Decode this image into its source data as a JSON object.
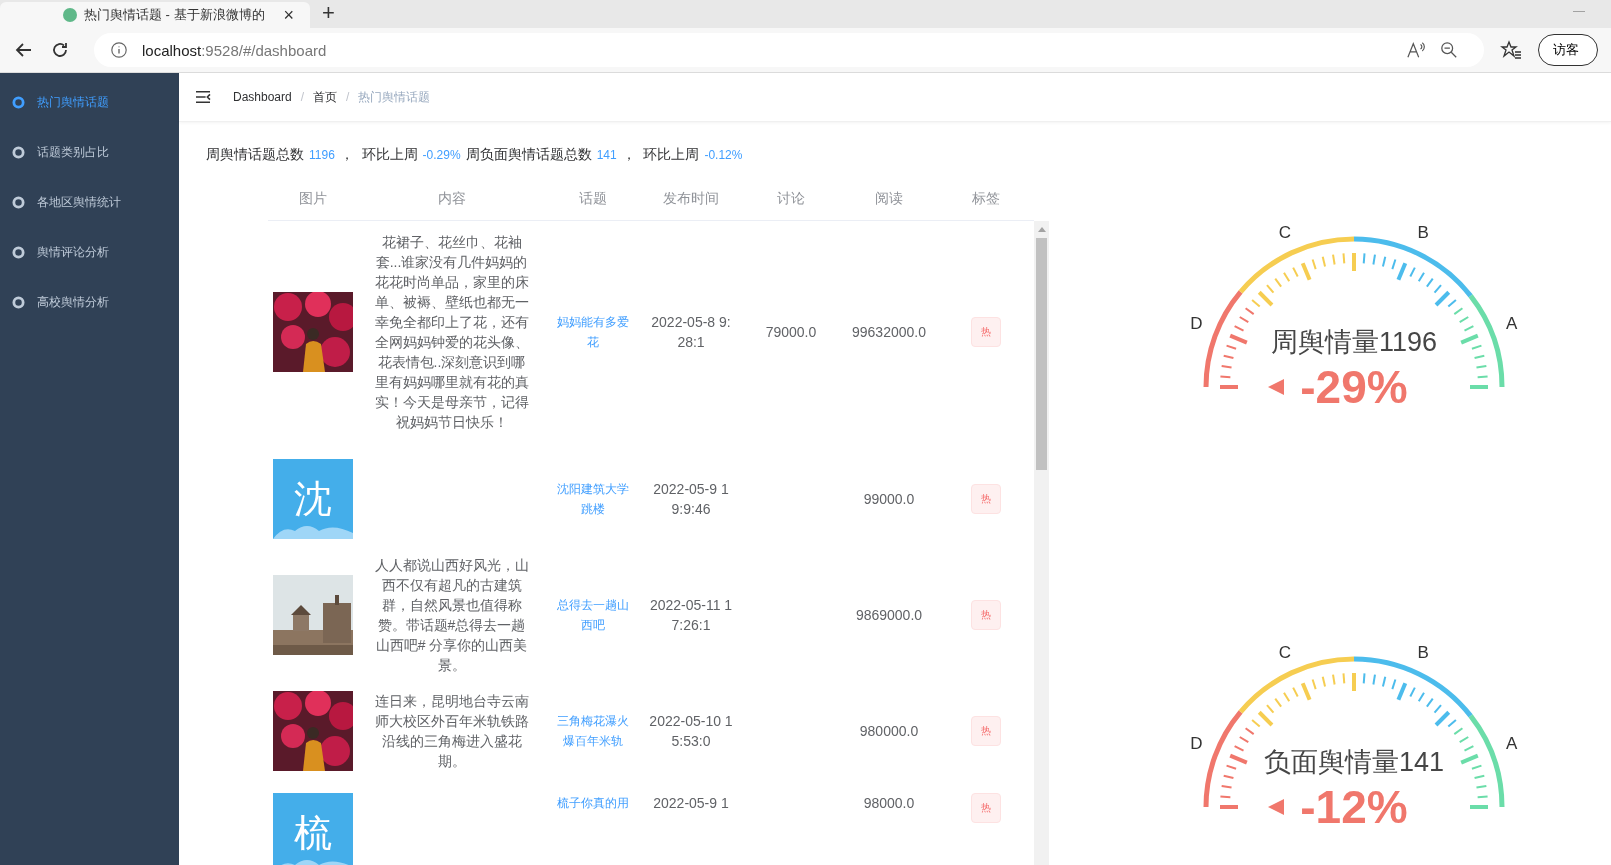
{
  "browser": {
    "tab_title": "热门舆情话题 - 基于新浪微博的",
    "tab_close": "×",
    "new_tab": "+",
    "minimize": "—",
    "url_host": "localhost",
    "url_path": ":9528/#/dashboard",
    "profile": "访客"
  },
  "sidebar": {
    "items": [
      {
        "label": "热门舆情话题",
        "selected": true
      },
      {
        "label": "话题类别占比",
        "selected": false
      },
      {
        "label": "各地区舆情统计",
        "selected": false
      },
      {
        "label": "舆情评论分析",
        "selected": false
      },
      {
        "label": "高校舆情分析",
        "selected": false
      }
    ]
  },
  "breadcrumb": [
    {
      "label": "Dashboard",
      "current": false
    },
    {
      "label": "首页",
      "current": false,
      "separator": "/"
    },
    {
      "label": "热门舆情话题",
      "current": true,
      "separator": "/"
    }
  ],
  "summary": [
    {
      "kind": "label",
      "text": "周舆情话题总数"
    },
    {
      "kind": "value",
      "text": "1196"
    },
    {
      "kind": "label",
      "text": "，  环比上周"
    },
    {
      "kind": "value",
      "text": "-0.29%"
    },
    {
      "kind": "label",
      "text": "周负面舆情话题总数"
    },
    {
      "kind": "value",
      "text": "141"
    },
    {
      "kind": "label",
      "text": "，  环比上周"
    },
    {
      "kind": "value",
      "text": "-0.12%"
    }
  ],
  "table": {
    "columns": [
      "图片",
      "内容",
      "话题",
      "发布时间",
      "讨论",
      "阅读",
      "标签"
    ],
    "rows": [
      {
        "content": "花裙子、花丝巾、花袖套...谁家没有几件妈妈的花花时尚单品，家里的床单、被褥、壁纸也都无一幸免全都印上了花，还有全网妈妈钟爱的花头像、花表情包..深刻意识到哪里有妈妈哪里就有花的真实！今天是母亲节，记得祝妈妈节日快乐！",
        "topic": "妈妈能有多爱花",
        "time": "2022-05-8 9:28:1",
        "discussion": "79000.0",
        "reads": "99632000.0",
        "tag": "热"
      },
      {
        "picture": {
          "kind": "letter",
          "letter": "沈"
        },
        "topic": "沈阳建筑大学跳楼",
        "time": "2022-05-9 19:9:46",
        "reads": "99000.0",
        "tag": "热"
      },
      {
        "content": "人人都说山西好风光，山西不仅有超凡的古建筑群，自然风景也值得称赞。带话题#总得去一趟山西吧# 分享你的山西美景。",
        "topic": "总得去一趟山西吧",
        "time": "2022-05-11 17:26:1",
        "reads": "9869000.0",
        "tag": "热"
      },
      {
        "content": "连日来，昆明地台寺云南师大校区外百年米轨铁路沿线的三角梅进入盛花期。",
        "topic": "三角梅花瀑火爆百年米轨",
        "time": "2022-05-10 15:53:0",
        "reads": "980000.0",
        "tag": "热"
      },
      {
        "picture": {
          "kind": "letter",
          "letter": "梳"
        },
        "topic": "梳子你真的用",
        "time": "2022-05-9 1",
        "reads": "98000.0",
        "tag": "热"
      }
    ]
  },
  "gauges": [
    {
      "title": "周舆情量1196",
      "percent": "-29%",
      "labels": [
        "D",
        "C",
        "B",
        "A"
      ]
    },
    {
      "title": "负面舆情量141",
      "percent": "-12%",
      "labels": [
        "D",
        "C",
        "B",
        "A"
      ]
    }
  ]
}
